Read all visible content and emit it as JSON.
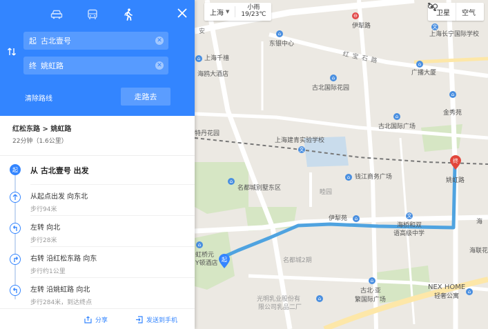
{
  "panel": {
    "modes": [
      {
        "name": "car",
        "icon": "car-icon",
        "active": false
      },
      {
        "name": "bus",
        "icon": "bus-icon",
        "active": false
      },
      {
        "name": "walk",
        "icon": "walk-icon",
        "active": true
      }
    ],
    "from_prefix": "起",
    "from_value": "古北壹号",
    "to_prefix": "终",
    "to_value": "姚虹路",
    "clear_route_label": "清除路线",
    "go_label": "走路去",
    "summary": {
      "route_name": "红松东路 > 姚虹路",
      "meta": "22分钟（1.6公里）"
    },
    "start_step": {
      "badge": "起",
      "title": "从 古北壹号 出发"
    },
    "steps": [
      {
        "title": "从起点出发 向东北",
        "dist": "步行94米",
        "icon": "arrow-up-icon"
      },
      {
        "title": "左转 向北",
        "dist": "步行28米",
        "icon": "turn-left-icon"
      },
      {
        "title": "右转 沿红松东路 向东",
        "dist": "步行约1公里",
        "icon": "turn-right-icon"
      },
      {
        "title": "左转 沿姚虹路 向北",
        "dist": "步行284米，到达终点",
        "icon": "turn-left-icon"
      }
    ],
    "share_label": "分享",
    "send_label": "发送到手机"
  },
  "map": {
    "city": "上海",
    "weather_desc": "小雨",
    "weather_temp": "19/23℃",
    "layers": [
      {
        "label": "卫星",
        "icon": "satellite-icon"
      },
      {
        "label": "空气",
        "icon": "air-quality-icon"
      }
    ],
    "end_marker": "终",
    "start_marker": "起",
    "labels": {
      "l1": "路",
      "l2": "伊犁路",
      "l3": "上海长宁国际学校",
      "l4": "东银中心",
      "l5": "红 宝 石 路",
      "l6": "上海千禧",
      "l7": "海鸥大酒店",
      "l8": "广播大厦",
      "l9": "古北国际花园",
      "l10": "金秀苑",
      "l11": "特丹花园",
      "l12": "古北国际广场",
      "l13": "上海建青实验学校",
      "l14": "钱江商务广场",
      "l15": "姚虹路",
      "l16": "名都城别墅东区",
      "l17": "睦园",
      "l18": "伊犁苑",
      "l19": "海桥和双",
      "l20": "语高级中学",
      "l21": "海",
      "l22": "海联花",
      "l23": "虹桥元",
      "l24": "Y顿酒店",
      "l25": "名都城2期",
      "l26": "古北·亚",
      "l27": "繁国际广场",
      "l28": "NEX HOME",
      "l29": "轻奢公寓",
      "l30": "光明乳业股份有",
      "l31": "限公司乳品二厂",
      "l32": "安"
    }
  }
}
